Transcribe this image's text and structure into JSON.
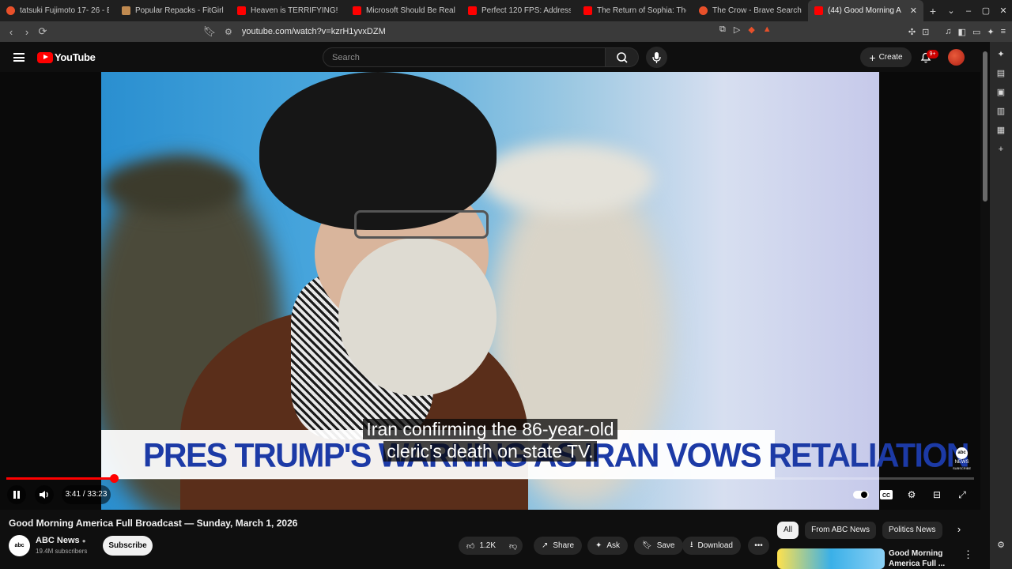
{
  "browser": {
    "tabs": [
      {
        "title": "tatsuki Fujimoto 17- 26 - Bra",
        "favicon_color": "#e8502a"
      },
      {
        "title": "Popular Repacks - FitGirl Re",
        "favicon_color": "#c08a50"
      },
      {
        "title": "Heaven is TERRIFYING! - Yo",
        "favicon_color": "#ff0000"
      },
      {
        "title": "Microsoft Should Be Really",
        "favicon_color": "#ff0000"
      },
      {
        "title": "Perfect 120 FPS: Addressing",
        "favicon_color": "#ff0000"
      },
      {
        "title": "The Return of Sophia: The F",
        "favicon_color": "#ff0000"
      },
      {
        "title": "The Crow - Brave Search",
        "favicon_color": "#e8502a"
      },
      {
        "title": "(44) Good Morning A",
        "favicon_color": "#ff0000",
        "active": true
      }
    ],
    "new_tab": "+",
    "url": "youtube.com/watch?v=kzrH1yvxDZM"
  },
  "youtube": {
    "logo_text": "YouTube",
    "search_placeholder": "Search",
    "create_label": "Create",
    "notif_count": "9+"
  },
  "video": {
    "banner_headline": "PRES TRUMP'S WARNING AS IRAN VOWS RETALIATION",
    "caption_line1": "Iran confirming the 86-year-old",
    "caption_line2": "cleric's death on state TV.",
    "bug_top": "abc",
    "bug_bottom": "NEWS",
    "bug_sub": "SUBSCRIBE",
    "time_current": "3:41",
    "time_total": "33:23",
    "time_display": "3:41 / 33:23",
    "progress_fraction": 0.111
  },
  "details": {
    "title": "Good Morning America Full Broadcast — Sunday, March 1, 2026",
    "channel_avatar_text": "abc",
    "channel_name": "ABC News",
    "subscribers": "19.4M subscribers",
    "subscribe_label": "Subscribe",
    "like_count": "1.2K",
    "share_label": "Share",
    "ask_label": "Ask",
    "save_label": "Save",
    "download_label": "Download"
  },
  "sidebar_chips": [
    "All",
    "From ABC News",
    "Politics News"
  ],
  "recommended": {
    "title": "Good Morning America Full ..."
  }
}
